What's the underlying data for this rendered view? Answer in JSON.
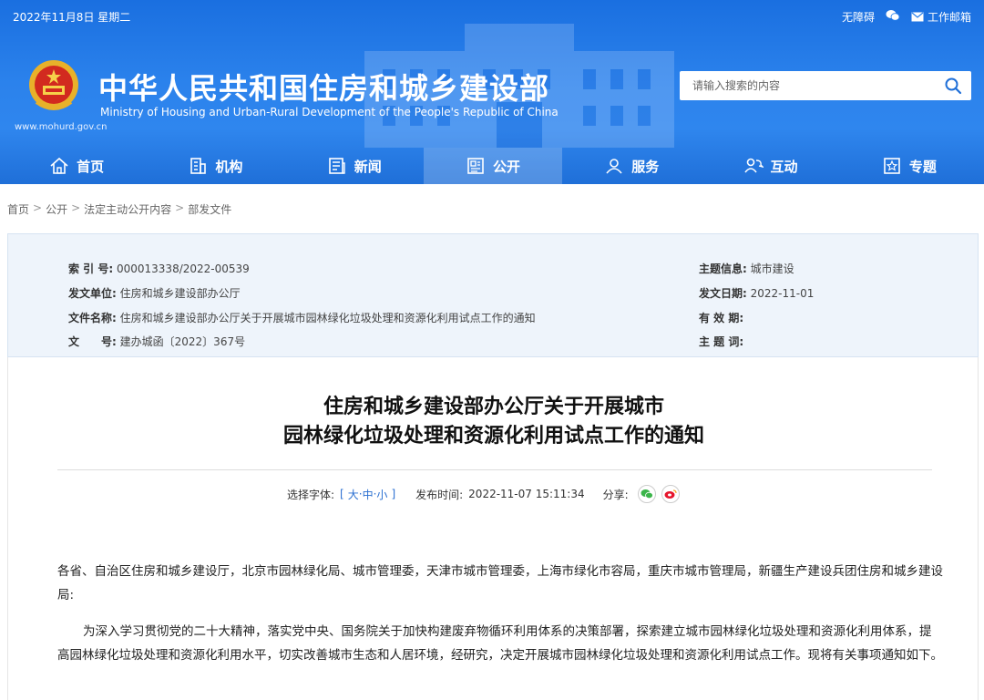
{
  "header": {
    "date": "2022年11月8日 星期二",
    "accessibility": "无障碍",
    "mail": "工作邮箱",
    "domain": "www.mohurd.gov.cn",
    "title_cn": "中华人民共和国住房和城乡建设部",
    "title_en": "Ministry of Housing and Urban-Rural Development of the People's Republic of China",
    "search_placeholder": "请输入搜索的内容"
  },
  "nav": [
    {
      "label": "首页",
      "icon": "home-icon"
    },
    {
      "label": "机构",
      "icon": "building-icon"
    },
    {
      "label": "新闻",
      "icon": "news-icon"
    },
    {
      "label": "公开",
      "icon": "disclosure-icon",
      "active": true
    },
    {
      "label": "服务",
      "icon": "service-icon"
    },
    {
      "label": "互动",
      "icon": "interaction-icon"
    },
    {
      "label": "专题",
      "icon": "topic-icon"
    }
  ],
  "breadcrumb": [
    "首页",
    "公开",
    "法定主动公开内容",
    "部发文件"
  ],
  "meta": {
    "index_key": "索 引 号:",
    "index_val": "000013338/2022-00539",
    "issuer_key": "发文单位:",
    "issuer_val": "住房和城乡建设部办公厅",
    "filename_key": "文件名称:",
    "filename_val": "住房和城乡建设部办公厅关于开展城市园林绿化垃圾处理和资源化利用试点工作的通知",
    "docno_key": "文　　号:",
    "docno_val": "建办城函〔2022〕367号",
    "topic_key": "主题信息:",
    "topic_val": "城市建设",
    "date_key": "发文日期:",
    "date_val": "2022-11-01",
    "validity_key": "有 效 期:",
    "subject_key": "主 题 词:"
  },
  "article": {
    "title_line1": "住房和城乡建设部办公厅关于开展城市",
    "title_line2": "园林绿化垃圾处理和资源化利用试点工作的通知",
    "font_label": "选择字体:",
    "font_open": "[",
    "font_large": "大",
    "font_medium": "中",
    "font_small": "小",
    "font_close": "]",
    "font_dot": "·",
    "publish_label": "发布时间:",
    "publish_time": "2022-11-07 15:11:34",
    "share_label": "分享:",
    "para1": "各省、自治区住房和城乡建设厅，北京市园林绿化局、城市管理委，天津市城市管理委，上海市绿化市容局，重庆市城市管理局，新疆生产建设兵团住房和城乡建设局:",
    "para2": "为深入学习贯彻党的二十大精神，落实党中央、国务院关于加快构建废弃物循环利用体系的决策部署，探索建立城市园林绿化垃圾处理和资源化利用体系，提高园林绿化垃圾处理和资源化利用水平，切实改善城市生态和人居环境，经研究，决定开展城市园林绿化垃圾处理和资源化利用试点工作。现将有关事项通知如下。"
  },
  "colors": {
    "header_blue": "#2b82ec",
    "meta_bg": "#eef4fb",
    "link_blue": "#2a6fd1"
  }
}
